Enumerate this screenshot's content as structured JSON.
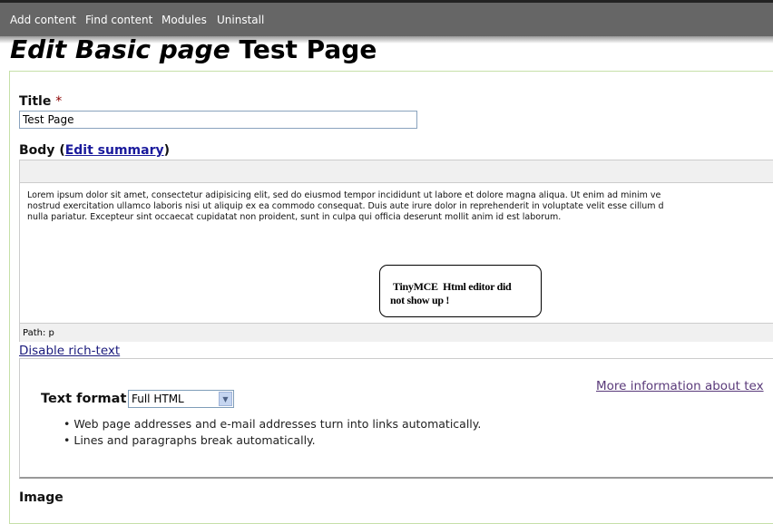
{
  "toolbar": {
    "items": [
      "Add content",
      "Find content",
      "Modules",
      "Uninstall"
    ]
  },
  "page_title": {
    "prefix": "Edit Basic page",
    "title": "Test Page"
  },
  "title_field": {
    "label": "Title",
    "required": "*",
    "value": "Test Page"
  },
  "body_field": {
    "label": "Body",
    "edit_summary": "Edit summary",
    "paren_open": "(",
    "paren_close": ")"
  },
  "editor": {
    "lines": [
      "Lorem ipsum dolor sit amet, consectetur adipisicing elit, sed do eiusmod tempor incididunt ut labore et dolore magna aliqua. Ut enim ad minim ve",
      "nostrud exercitation ullamco laboris nisi ut aliquip ex ea commodo consequat. Duis aute irure dolor in reprehenderit in voluptate velit esse cillum d",
      "nulla pariatur. Excepteur sint occaecat cupidatat non proident, sunt in culpa qui officia deserunt mollit anim id est laborum."
    ],
    "note_line1": "TinyMCE  Html editor did",
    "note_line2": "not show up !",
    "path": "Path: p"
  },
  "disable_rich_text": "Disable rich-text",
  "text_format": {
    "label": "Text format",
    "selected": "Full HTML",
    "more_info": "More information about tex",
    "tips": [
      "Web page addresses and e-mail addresses turn into links automatically.",
      "Lines and paragraphs break automatically."
    ]
  },
  "image_label": "Image"
}
